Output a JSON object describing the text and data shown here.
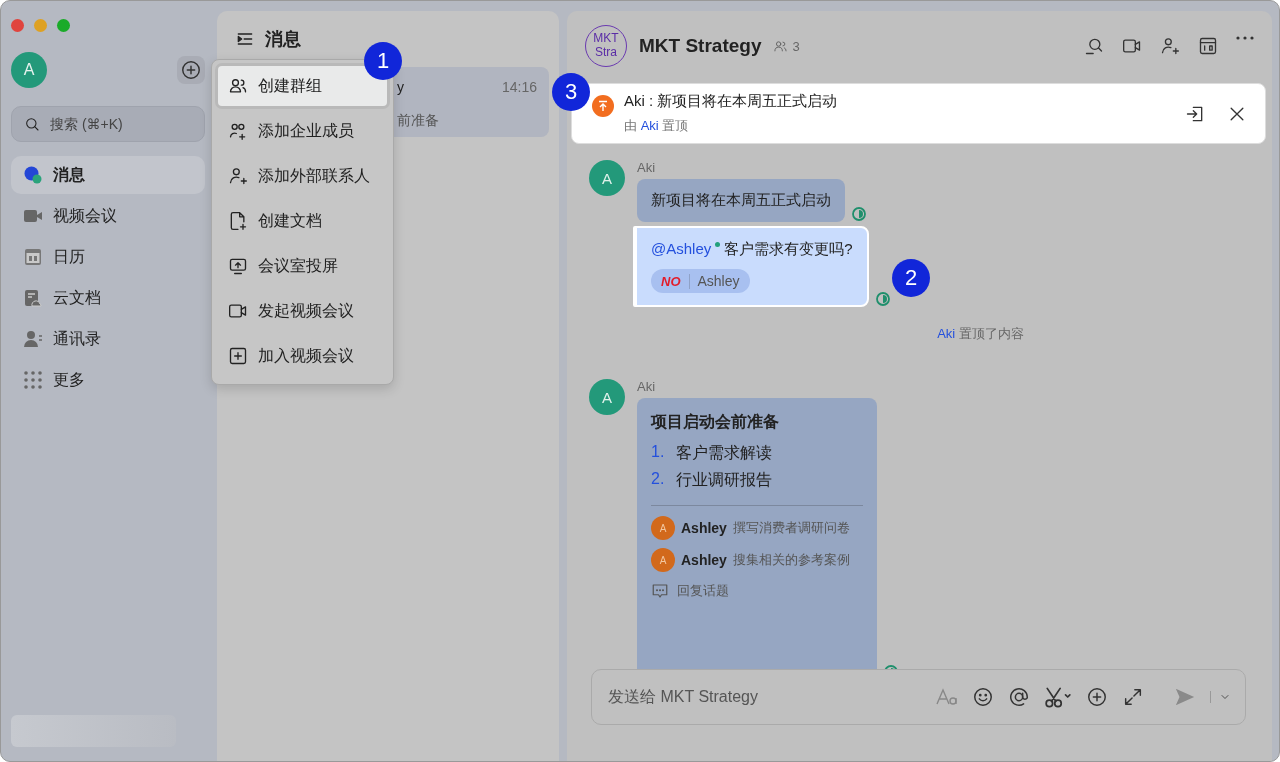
{
  "sidebar": {
    "avatar": "A",
    "search": {
      "placeholder": "搜索 (⌘+K)"
    },
    "items": [
      {
        "kind": "chat",
        "label": "消息",
        "selected": true
      },
      {
        "kind": "video",
        "label": "视频会议",
        "selected": false
      },
      {
        "kind": "calendar",
        "label": "日历",
        "selected": false
      },
      {
        "kind": "docs",
        "label": "云文档",
        "selected": false
      },
      {
        "kind": "contacts",
        "label": "通讯录",
        "selected": false
      },
      {
        "kind": "more",
        "label": "更多",
        "selected": false
      }
    ]
  },
  "list_panel": {
    "title": "消息",
    "chats": [
      {
        "title": "y",
        "time": "14:16",
        "preview": "前准备",
        "selected": true
      }
    ]
  },
  "menu": {
    "items": [
      {
        "kind": "group",
        "label": "创建群组",
        "selected": true
      },
      {
        "kind": "members",
        "label": "添加企业成员",
        "selected": false
      },
      {
        "kind": "contact",
        "label": "添加外部联系人",
        "selected": false
      },
      {
        "kind": "doc",
        "label": "创建文档",
        "selected": false
      },
      {
        "kind": "screen",
        "label": "会议室投屏",
        "selected": false
      },
      {
        "kind": "video",
        "label": "发起视频会议",
        "selected": false
      },
      {
        "kind": "join",
        "label": "加入视频会议",
        "selected": false
      }
    ]
  },
  "callouts": [
    "1",
    "2",
    "3"
  ],
  "chat": {
    "avatar_lines": [
      "MKT",
      "Stra"
    ],
    "title": "MKT Strategy",
    "member_count": "3",
    "pinned": {
      "text": "Aki : 新项目将在本周五正式启动",
      "by_prefix": "由",
      "by_name": "Aki",
      "by_suffix": "置顶"
    },
    "messages": [
      {
        "kind": "message",
        "sender": "Aki",
        "avatar": "A",
        "bubbles": [
          {
            "kind": "text",
            "text": "新项目将在本周五正式启动",
            "highlighted": false
          },
          {
            "kind": "mention",
            "mention": "@Ashley",
            "text": "客户需求有变更吗?",
            "reaction": "NO",
            "reaction_user": "Ashley",
            "highlighted": true
          }
        ]
      },
      {
        "kind": "system",
        "name": "Aki",
        "text": "置顶了内容"
      },
      {
        "kind": "message",
        "sender": "Aki",
        "avatar": "A",
        "bubbles": [
          {
            "kind": "card",
            "title": "项目启动会前准备",
            "highlighted": false,
            "list": [
              {
                "number": "1.",
                "text": "客户需求解读"
              },
              {
                "number": "2.",
                "text": "行业调研报告"
              }
            ],
            "tasks": [
              {
                "avatar": "A",
                "name": "Ashley",
                "text": "撰写消费者调研问卷"
              },
              {
                "avatar": "A",
                "name": "Ashley",
                "text": "搜集相关的参考案例"
              }
            ],
            "reply": "回复话题"
          }
        ]
      }
    ],
    "composer": {
      "placeholder": "发送给 MKT Strategy"
    }
  }
}
